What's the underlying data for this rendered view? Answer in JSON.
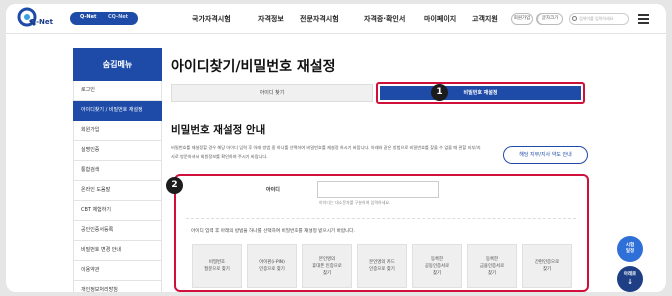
{
  "header": {
    "logo_text": "Q-Net",
    "site_pill": {
      "primary": "Q-Net",
      "secondary": "CQ-Net"
    },
    "nav": [
      "국가자격시험",
      "자격정보",
      "전문자격시험",
      "자격증·확인서",
      "마이페이지",
      "고객지원"
    ],
    "top_buttons": [
      "회원가입",
      "로그인",
      "글자크기"
    ],
    "search_placeholder": "검색어를 입력하세요",
    "icons": {
      "search": "search-icon",
      "menu": "hamburger-icon"
    }
  },
  "sidebar": {
    "title": "숨김메뉴",
    "items": [
      {
        "label": "로그인",
        "active": false
      },
      {
        "label": "아이디찾기 / 비밀번호 재설정",
        "active": true
      },
      {
        "label": "회원가입",
        "active": false
      },
      {
        "label": "실명인증",
        "active": false
      },
      {
        "label": "통합검색",
        "active": false
      },
      {
        "label": "온라인 도움말",
        "active": false
      },
      {
        "label": "CBT 체험하기",
        "active": false
      },
      {
        "label": "공인인증서등록",
        "active": false
      },
      {
        "label": "비밀번호 변경 안내",
        "active": false
      },
      {
        "label": "이용약관",
        "active": false
      },
      {
        "label": "개인정보처리방침",
        "active": false
      }
    ]
  },
  "main": {
    "title": "아이디찾기/비밀번호 재설정",
    "tabs": [
      {
        "label": "아이디 찾기",
        "selected": false
      },
      {
        "label": "비밀번호 재설정",
        "selected": true
      }
    ],
    "section_title": "비밀번호 재설정 안내",
    "description": "비밀번호를 재설정할 경우 해당 아이디 입력 후 아래 방법 중 하나를 선택하여 비밀번호를 재설정 하시기 바랍니다. 아래와 같은 방법으로 비밀번호를 찾을 수 없을 때 관할 지부/지사로 방문하셔서 회원정보를 확인하여 주시기 바랍니다.",
    "guide_button": "해당 지부/지사 약도 안내",
    "form": {
      "id_label": "아이디",
      "id_value": "",
      "id_help": "아이디는 대소문자를 구분하여 입력하세요.",
      "methods_desc": "아이디 입력 후 아래의 방법을 하나를 선택하여 비밀번호를 재설정 받으시기 바랍니다.",
      "methods": [
        "비밀번호\n질문으로 찾기",
        "아이핀(i-PIN)\n인증으로 찾기",
        "본인명의\n휴대폰 인증으로\n찾기",
        "본인명의 카드\n인증으로 찾기",
        "등록한\n공동인증서로\n찾기",
        "등록한\n금융인증서로\n찾기",
        "간편인증으로\n찾기"
      ]
    }
  },
  "annotations": {
    "badge1": "1",
    "badge2": "2"
  },
  "floating": {
    "fab1": "시험\n일정",
    "fab2": "아래로"
  },
  "colors": {
    "brand": "#1e4ba8",
    "highlight": "#d0103a"
  }
}
